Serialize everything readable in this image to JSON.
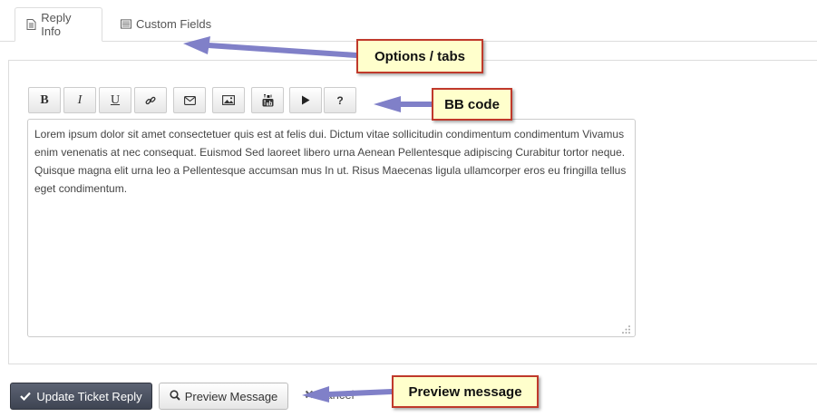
{
  "tabs": {
    "reply_info": "Reply Info",
    "custom_fields": "Custom Fields"
  },
  "toolbar": {
    "bold": "B",
    "italic": "I",
    "underline": "U",
    "help": "?"
  },
  "editor": {
    "text": "Lorem ipsum dolor sit amet consectetuer quis est at felis dui. Dictum vitae sollicitudin condimentum condimentum Vivamus enim venenatis at nec consequat. Euismod Sed laoreet libero urna Aenean Pellentesque adipiscing Curabitur tortor neque. Quisque magna elit urna leo a Pellentesque accumsan mus In ut. Risus Maecenas ligula ullamcorper eros eu fringilla tellus eget condimentum."
  },
  "actions": {
    "update_label": "Update Ticket Reply",
    "preview_label": "Preview Message",
    "cancel_label": "Cancel"
  },
  "callouts": {
    "options_tabs": "Options / tabs",
    "bb_code": "BB code",
    "preview_message": "Preview message"
  },
  "colors": {
    "callout_bg": "#ffffcc",
    "callout_border": "#c0392b",
    "arrow": "#8080c8",
    "primary_button": "#474d5b"
  },
  "icons": [
    "file-icon",
    "list-icon",
    "link-icon",
    "envelope-icon",
    "image-icon",
    "youtube-icon",
    "play-icon",
    "check-icon",
    "search-icon",
    "times-icon",
    "resize-grip-icon"
  ]
}
